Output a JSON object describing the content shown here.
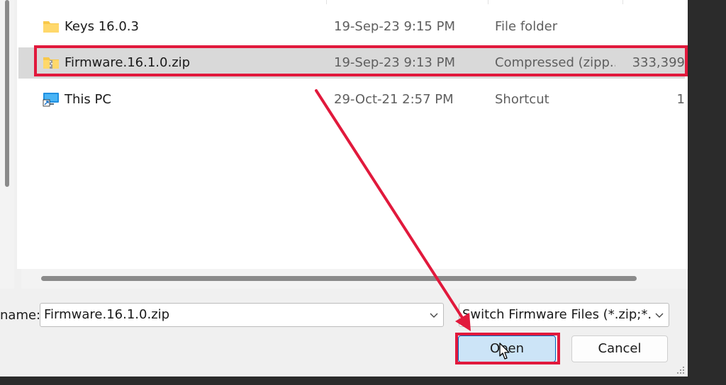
{
  "file_list": {
    "rows": [
      {
        "name": "Keys 16.0.3",
        "date": "19-Sep-23 9:15 PM",
        "type": "File folder",
        "size": "",
        "icon": "folder-icon",
        "selected": false
      },
      {
        "name": "Firmware.16.1.0.zip",
        "date": "19-Sep-23 9:13 PM",
        "type": "Compressed (zipp...",
        "size": "333,399",
        "icon": "zip-folder-icon",
        "selected": true
      },
      {
        "name": "This PC",
        "date": "29-Oct-21 2:57 PM",
        "type": "Shortcut",
        "size": "1",
        "icon": "this-pc-shortcut-icon",
        "selected": false
      }
    ]
  },
  "footer": {
    "filename_label": "name:",
    "filename_value": "Firmware.16.1.0.zip",
    "filetype_value": "Switch Firmware Files (*.zip;*.xci",
    "open_label": "Open",
    "cancel_label": "Cancel"
  },
  "colors": {
    "annotation": "#e1193c",
    "selection": "#d9d9d9",
    "primary_button": "#cce4f7",
    "primary_border": "#0067c0"
  }
}
